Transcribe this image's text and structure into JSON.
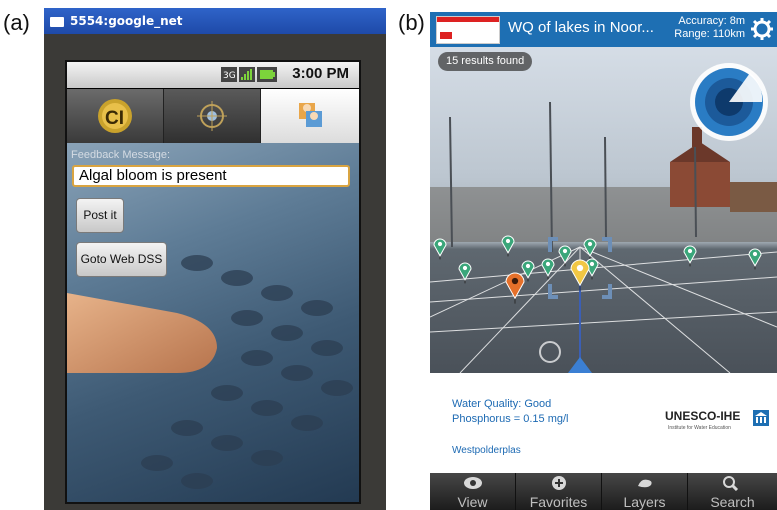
{
  "labels": {
    "a": "(a)",
    "b": "(b)"
  },
  "panel_a": {
    "window_title": "5554:google_net",
    "status_time": "3:00 PM",
    "feedback_label": "Feedback Message:",
    "feedback_value": "Algal bloom is present",
    "post_button": "Post it",
    "goto_button": "Goto Web DSS",
    "tab_icons": [
      "ci-logo-icon",
      "target-icon",
      "users-icon"
    ]
  },
  "panel_b": {
    "title": "WQ of lakes in Noor...",
    "accuracy": "Accuracy: 8m",
    "range": "Range: 110km",
    "results": "15 results found",
    "water_quality": "Water Quality: Good",
    "phosphorus": "Phosphorus = 0.15 mg/l",
    "lake": "Westpolderplas",
    "org": "UNESCO-IHE",
    "org_sub": "Institute for Water Education",
    "nav": [
      "View",
      "Favorites",
      "Layers",
      "Search"
    ],
    "colors": {
      "header": "#1e6fb3",
      "marker": "#3aa67a",
      "selected_marker": "#f2c744",
      "alt_marker": "#e5702a"
    }
  }
}
